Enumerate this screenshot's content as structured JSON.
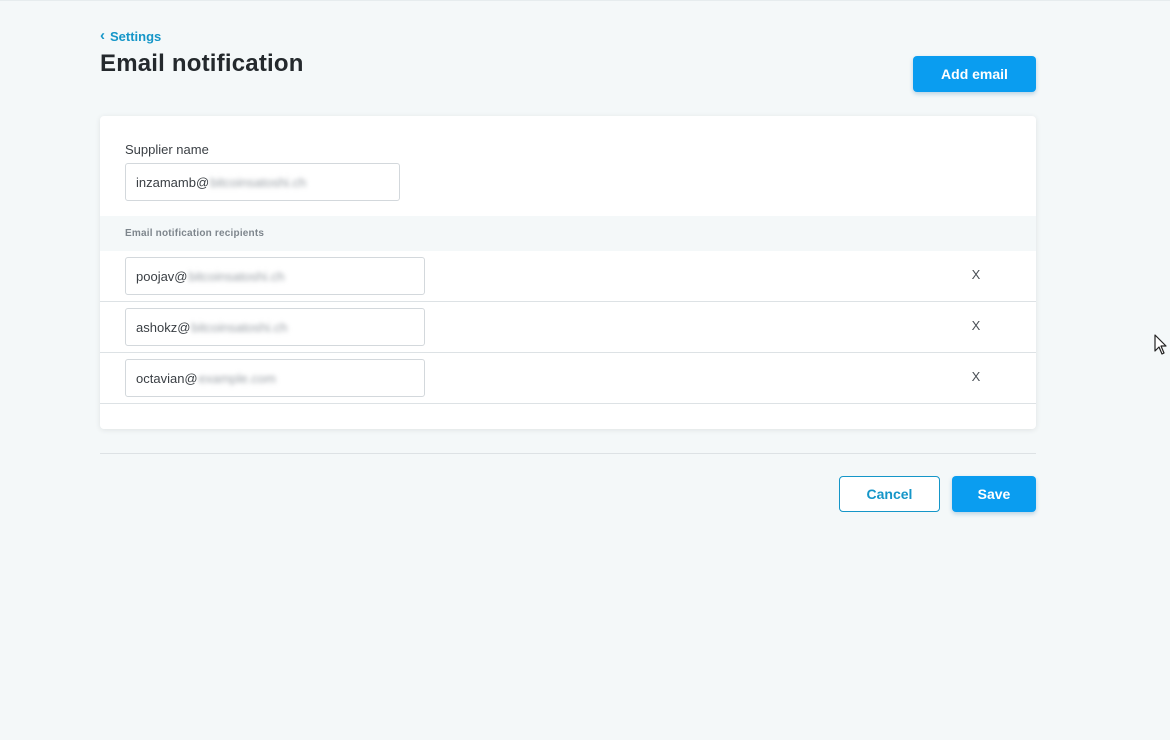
{
  "header": {
    "breadcrumb": "Settings",
    "title": "Email notification",
    "add_email_label": "Add email"
  },
  "supplier": {
    "label": "Supplier name",
    "value_visible": "inzamamb@",
    "value_blurred": "bitcoinsatoshi.ch"
  },
  "recipients": {
    "header": "Email notification recipients",
    "items": [
      {
        "visible": "poojav@",
        "blurred": "bitcoinsatoshi.ch",
        "remove": "X"
      },
      {
        "visible": "ashokz@",
        "blurred": "bitcoinsatoshi.ch",
        "remove": "X"
      },
      {
        "visible": "octavian@",
        "blurred": "example.com",
        "remove": "X"
      }
    ]
  },
  "footer": {
    "cancel_label": "Cancel",
    "save_label": "Save"
  },
  "icons": {
    "back": "chevron-left-icon",
    "remove": "close-icon",
    "cursor": "mouse-pointer-icon"
  },
  "colors": {
    "accent": "#0a9df0",
    "link": "#1596c8",
    "background": "#f4f8f9"
  }
}
